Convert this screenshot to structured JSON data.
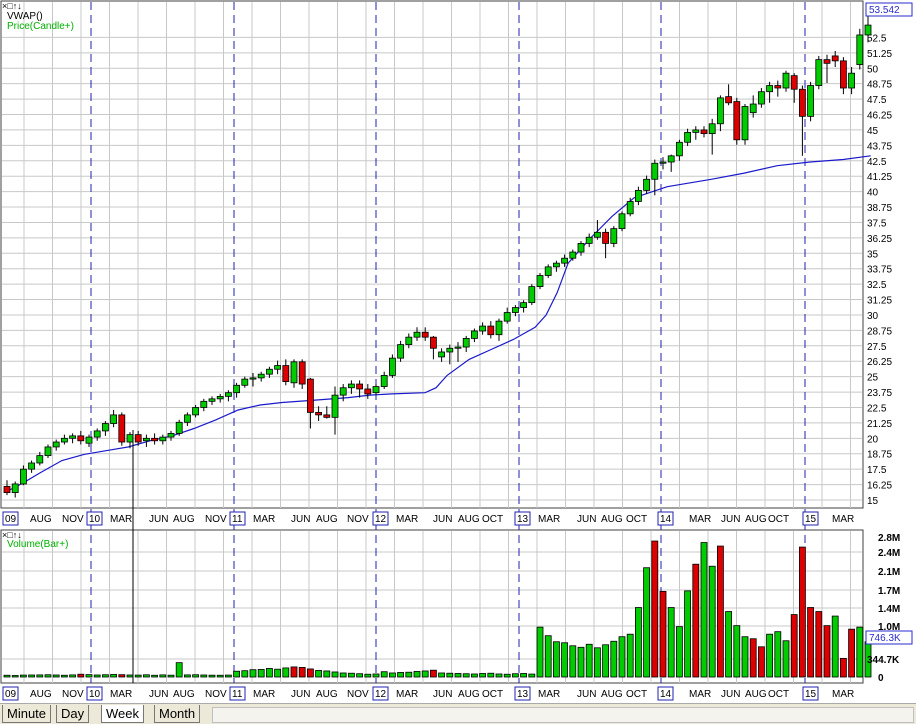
{
  "panel_controls": "×□↑↓",
  "legend": {
    "vwap": "VWAP()",
    "price": "Price(Candle+)",
    "volume": "Volume(Bar+)"
  },
  "last_price": "53.542",
  "last_volume": "746.3K",
  "tabs": [
    "Minute",
    "Day",
    "Week",
    "Month"
  ],
  "colors": {
    "up": "#00cc00",
    "down": "#dd0000",
    "vwap": "#1a1acc",
    "grid": "#c8c8c8",
    "separator": "#2020b0"
  },
  "price_axis_ticks": [
    "52.5",
    "51.25",
    "50",
    "48.75",
    "47.5",
    "46.25",
    "45",
    "43.75",
    "42.5",
    "41.25",
    "40",
    "38.75",
    "37.5",
    "36.25",
    "35",
    "33.75",
    "32.5",
    "31.25",
    "30",
    "28.75",
    "27.5",
    "26.25",
    "25",
    "23.75",
    "22.5",
    "21.25",
    "20",
    "18.75",
    "17.5",
    "16.25",
    "15"
  ],
  "volume_axis_ticks": [
    "2.8M",
    "2.4M",
    "2.1M",
    "1.7M",
    "1.4M",
    "1.0M",
    "344.7K",
    "0"
  ],
  "time_axis": [
    "09",
    "AUG",
    "NOV",
    "10",
    "MAR",
    "JUN",
    "AUG",
    "NOV",
    "11",
    "MAR",
    "JUN",
    "AUG",
    "NOV",
    "12",
    "MAR",
    "JUN",
    "AUG",
    "OCT",
    "13",
    "MAR",
    "JUN",
    "AUG",
    "OCT",
    "14",
    "MAR",
    "JUN",
    "AUG",
    "OCT",
    "15",
    "MAR"
  ],
  "chart_data": {
    "type": "candlestick",
    "period": "weekly",
    "ylim": [
      15,
      53.75
    ],
    "volume_ylim": [
      0,
      2800000
    ],
    "candles": [
      [
        16.1,
        16.6,
        15.4,
        15.6
      ],
      [
        15.6,
        16.5,
        15.2,
        16.3
      ],
      [
        16.3,
        17.8,
        16.2,
        17.5
      ],
      [
        17.5,
        18.2,
        17.2,
        18.0
      ],
      [
        18.0,
        18.9,
        17.8,
        18.6
      ],
      [
        18.6,
        19.5,
        18.4,
        19.3
      ],
      [
        19.3,
        19.9,
        19.0,
        19.7
      ],
      [
        19.7,
        20.3,
        19.5,
        20.0
      ],
      [
        20.0,
        20.4,
        19.6,
        20.2
      ],
      [
        20.2,
        20.6,
        19.5,
        19.8
      ],
      [
        19.6,
        20.3,
        19.3,
        20.1
      ],
      [
        20.1,
        20.8,
        19.8,
        20.6
      ],
      [
        20.6,
        21.4,
        20.2,
        21.2
      ],
      [
        21.2,
        22.3,
        20.9,
        21.9
      ],
      [
        21.9,
        22.1,
        19.4,
        19.7
      ],
      [
        19.7,
        20.5,
        19.2,
        20.3
      ],
      [
        20.3,
        20.6,
        19.4,
        19.7
      ],
      [
        19.8,
        20.3,
        19.3,
        20.0
      ],
      [
        20.0,
        20.4,
        19.5,
        19.8
      ],
      [
        19.8,
        20.3,
        19.5,
        20.1
      ],
      [
        20.1,
        20.6,
        19.8,
        20.4
      ],
      [
        20.4,
        21.5,
        20.2,
        21.3
      ],
      [
        21.3,
        22.1,
        21.0,
        21.9
      ],
      [
        21.9,
        22.7,
        21.7,
        22.5
      ],
      [
        22.5,
        23.2,
        22.2,
        23.0
      ],
      [
        23.0,
        23.4,
        22.7,
        23.2
      ],
      [
        23.2,
        23.6,
        22.9,
        23.4
      ],
      [
        23.4,
        23.9,
        23.0,
        23.7
      ],
      [
        23.7,
        24.5,
        23.3,
        24.3
      ],
      [
        24.3,
        25.0,
        24.1,
        24.8
      ],
      [
        24.8,
        25.3,
        24.2,
        24.9
      ],
      [
        24.9,
        25.4,
        24.6,
        25.2
      ],
      [
        25.2,
        25.8,
        24.9,
        25.6
      ],
      [
        25.6,
        26.3,
        25.2,
        25.9
      ],
      [
        25.9,
        26.4,
        24.3,
        24.6
      ],
      [
        24.5,
        26.4,
        24.1,
        26.2
      ],
      [
        26.2,
        26.4,
        24.0,
        24.4
      ],
      [
        24.8,
        24.9,
        20.8,
        22.1
      ],
      [
        22.1,
        22.6,
        21.4,
        21.9
      ],
      [
        21.9,
        22.6,
        21.6,
        21.7
      ],
      [
        21.7,
        24.2,
        20.3,
        23.5
      ],
      [
        23.5,
        24.4,
        23.0,
        24.1
      ],
      [
        24.1,
        24.7,
        23.6,
        24.4
      ],
      [
        24.4,
        24.7,
        23.3,
        24.0
      ],
      [
        24.0,
        24.4,
        23.2,
        23.6
      ],
      [
        23.7,
        24.4,
        23.5,
        24.2
      ],
      [
        24.2,
        25.4,
        24.0,
        25.1
      ],
      [
        25.1,
        26.8,
        24.9,
        26.5
      ],
      [
        26.5,
        27.9,
        26.2,
        27.6
      ],
      [
        27.6,
        28.5,
        27.3,
        28.2
      ],
      [
        28.2,
        29.0,
        27.9,
        28.6
      ],
      [
        28.6,
        29.0,
        27.9,
        28.2
      ],
      [
        28.2,
        28.3,
        26.4,
        27.3
      ],
      [
        26.6,
        27.3,
        26.2,
        27.0
      ],
      [
        27.0,
        27.6,
        26.0,
        27.3
      ],
      [
        27.3,
        27.8,
        26.2,
        27.4
      ],
      [
        27.4,
        28.3,
        27.0,
        28.1
      ],
      [
        28.1,
        28.9,
        27.8,
        28.7
      ],
      [
        28.7,
        29.4,
        28.4,
        29.1
      ],
      [
        29.1,
        29.5,
        28.1,
        28.4
      ],
      [
        28.4,
        29.7,
        27.9,
        29.5
      ],
      [
        29.5,
        30.6,
        29.3,
        30.2
      ],
      [
        30.2,
        30.8,
        29.9,
        30.6
      ],
      [
        30.6,
        31.2,
        30.2,
        31.0
      ],
      [
        31.0,
        32.5,
        30.8,
        32.3
      ],
      [
        32.3,
        33.4,
        32.1,
        33.2
      ],
      [
        33.2,
        34.1,
        33.0,
        33.9
      ],
      [
        33.9,
        34.4,
        33.5,
        34.2
      ],
      [
        34.2,
        34.9,
        33.9,
        34.6
      ],
      [
        34.6,
        35.3,
        34.4,
        35.1
      ],
      [
        35.1,
        36.0,
        34.8,
        35.8
      ],
      [
        35.8,
        36.6,
        35.5,
        36.3
      ],
      [
        36.3,
        37.7,
        36.1,
        36.7
      ],
      [
        36.7,
        37.0,
        34.6,
        35.8
      ],
      [
        35.8,
        37.2,
        35.5,
        37.0
      ],
      [
        37.0,
        38.4,
        36.8,
        38.2
      ],
      [
        38.2,
        39.5,
        38.0,
        39.2
      ],
      [
        39.2,
        40.4,
        38.9,
        40.1
      ],
      [
        40.1,
        41.3,
        39.8,
        41.0
      ],
      [
        41.0,
        42.6,
        39.7,
        42.3
      ],
      [
        42.3,
        42.8,
        41.8,
        42.4
      ],
      [
        42.4,
        43.0,
        41.6,
        42.9
      ],
      [
        42.9,
        44.2,
        42.5,
        44.0
      ],
      [
        44.0,
        45.1,
        43.7,
        44.8
      ],
      [
        44.8,
        45.3,
        44.2,
        45.0
      ],
      [
        45.0,
        45.3,
        44.4,
        44.7
      ],
      [
        44.7,
        45.9,
        43.0,
        45.5
      ],
      [
        45.5,
        47.8,
        44.9,
        47.6
      ],
      [
        47.7,
        48.7,
        47.0,
        47.2
      ],
      [
        47.3,
        47.6,
        43.8,
        44.2
      ],
      [
        44.2,
        47.1,
        43.8,
        46.9
      ],
      [
        46.4,
        47.8,
        46.0,
        47.1
      ],
      [
        47.1,
        48.4,
        46.8,
        48.1
      ],
      [
        48.1,
        48.9,
        47.2,
        48.6
      ],
      [
        48.6,
        49.0,
        47.7,
        48.4
      ],
      [
        48.4,
        49.8,
        48.1,
        49.6
      ],
      [
        49.4,
        49.6,
        47.2,
        48.3
      ],
      [
        48.3,
        48.6,
        42.9,
        46.1
      ],
      [
        46.1,
        48.9,
        45.7,
        48.6
      ],
      [
        48.6,
        51.0,
        48.3,
        50.7
      ],
      [
        50.7,
        51.1,
        48.8,
        50.4
      ],
      [
        51.0,
        51.4,
        50.1,
        50.6
      ],
      [
        50.6,
        50.9,
        47.9,
        48.4
      ],
      [
        48.4,
        50.1,
        47.9,
        49.6
      ],
      [
        50.3,
        53.2,
        49.9,
        52.7
      ],
      [
        52.7,
        54.3,
        52.1,
        53.5
      ]
    ],
    "vwap": [
      [
        0,
        15.7
      ],
      [
        3,
        16.4
      ],
      [
        6,
        17.2
      ],
      [
        10,
        18.2
      ],
      [
        14,
        18.7
      ],
      [
        18,
        19.0
      ],
      [
        22,
        19.3
      ],
      [
        26,
        19.8
      ],
      [
        30,
        20.2
      ],
      [
        34,
        20.8
      ],
      [
        38,
        21.5
      ],
      [
        42,
        22.3
      ],
      [
        46,
        22.7
      ],
      [
        50,
        22.9
      ],
      [
        56,
        23.1
      ],
      [
        62,
        23.3
      ],
      [
        66,
        23.5
      ],
      [
        70,
        23.6
      ],
      [
        76,
        23.7
      ],
      [
        78,
        24.1
      ],
      [
        80,
        25.1
      ],
      [
        84,
        26.4
      ],
      [
        88,
        27.2
      ],
      [
        92,
        28.0
      ],
      [
        96,
        29.0
      ],
      [
        98,
        30.0
      ],
      [
        100,
        31.8
      ],
      [
        102,
        34.2
      ],
      [
        106,
        36.2
      ],
      [
        110,
        38.0
      ],
      [
        114,
        39.5
      ],
      [
        120,
        40.4
      ],
      [
        128,
        41.0
      ],
      [
        134,
        41.5
      ],
      [
        140,
        42.1
      ],
      [
        146,
        42.4
      ],
      [
        152,
        42.6
      ],
      [
        157,
        42.9
      ]
    ],
    "volume": [
      [
        35000,
        0
      ],
      [
        30000,
        0
      ],
      [
        38000,
        0
      ],
      [
        40000,
        0
      ],
      [
        42000,
        0
      ],
      [
        45000,
        0
      ],
      [
        40000,
        0
      ],
      [
        35000,
        0
      ],
      [
        42000,
        0
      ],
      [
        55000,
        1
      ],
      [
        48000,
        0
      ],
      [
        40000,
        0
      ],
      [
        45000,
        0
      ],
      [
        50000,
        0
      ],
      [
        46000,
        1
      ],
      [
        40000,
        0
      ],
      [
        38000,
        0
      ],
      [
        44000,
        0
      ],
      [
        35000,
        0
      ],
      [
        42000,
        0
      ],
      [
        36000,
        0
      ],
      [
        285000,
        0
      ],
      [
        42000,
        0
      ],
      [
        45000,
        0
      ],
      [
        40000,
        0
      ],
      [
        36000,
        0
      ],
      [
        35000,
        0
      ],
      [
        38000,
        0
      ],
      [
        115000,
        0
      ],
      [
        125000,
        0
      ],
      [
        145000,
        0
      ],
      [
        150000,
        0
      ],
      [
        170000,
        0
      ],
      [
        155000,
        0
      ],
      [
        180000,
        0
      ],
      [
        200000,
        1
      ],
      [
        190000,
        1
      ],
      [
        160000,
        1
      ],
      [
        130000,
        0
      ],
      [
        120000,
        0
      ],
      [
        100000,
        0
      ],
      [
        80000,
        0
      ],
      [
        75000,
        0
      ],
      [
        65000,
        0
      ],
      [
        55000,
        0
      ],
      [
        60000,
        0
      ],
      [
        105000,
        0
      ],
      [
        80000,
        0
      ],
      [
        90000,
        0
      ],
      [
        95000,
        0
      ],
      [
        110000,
        0
      ],
      [
        120000,
        0
      ],
      [
        135000,
        1
      ],
      [
        80000,
        0
      ],
      [
        75000,
        0
      ],
      [
        70000,
        0
      ],
      [
        65000,
        0
      ],
      [
        60000,
        0
      ],
      [
        70000,
        0
      ],
      [
        75000,
        0
      ],
      [
        60000,
        0
      ],
      [
        55000,
        0
      ],
      [
        65000,
        0
      ],
      [
        70000,
        0
      ],
      [
        58000,
        0
      ],
      [
        990000,
        0
      ],
      [
        820000,
        0
      ],
      [
        700000,
        0
      ],
      [
        680000,
        0
      ],
      [
        620000,
        0
      ],
      [
        590000,
        0
      ],
      [
        650000,
        0
      ],
      [
        580000,
        0
      ],
      [
        640000,
        0
      ],
      [
        710000,
        0
      ],
      [
        800000,
        0
      ],
      [
        850000,
        0
      ],
      [
        1380000,
        0
      ],
      [
        2170000,
        0
      ],
      [
        2700000,
        1
      ],
      [
        1700000,
        1
      ],
      [
        1380000,
        0
      ],
      [
        1000000,
        0
      ],
      [
        1710000,
        0
      ],
      [
        2240000,
        1
      ],
      [
        2670000,
        0
      ],
      [
        2200000,
        0
      ],
      [
        2600000,
        1
      ],
      [
        1300000,
        0
      ],
      [
        1020000,
        0
      ],
      [
        800000,
        0
      ],
      [
        760000,
        1
      ],
      [
        600000,
        1
      ],
      [
        850000,
        0
      ],
      [
        900000,
        0
      ],
      [
        720000,
        0
      ],
      [
        1240000,
        1
      ],
      [
        2580000,
        1
      ],
      [
        1380000,
        1
      ],
      [
        1300000,
        1
      ],
      [
        1020000,
        1
      ],
      [
        1210000,
        0
      ],
      [
        370000,
        1
      ],
      [
        950000,
        1
      ],
      [
        990000,
        0
      ],
      [
        700000,
        0
      ]
    ]
  }
}
